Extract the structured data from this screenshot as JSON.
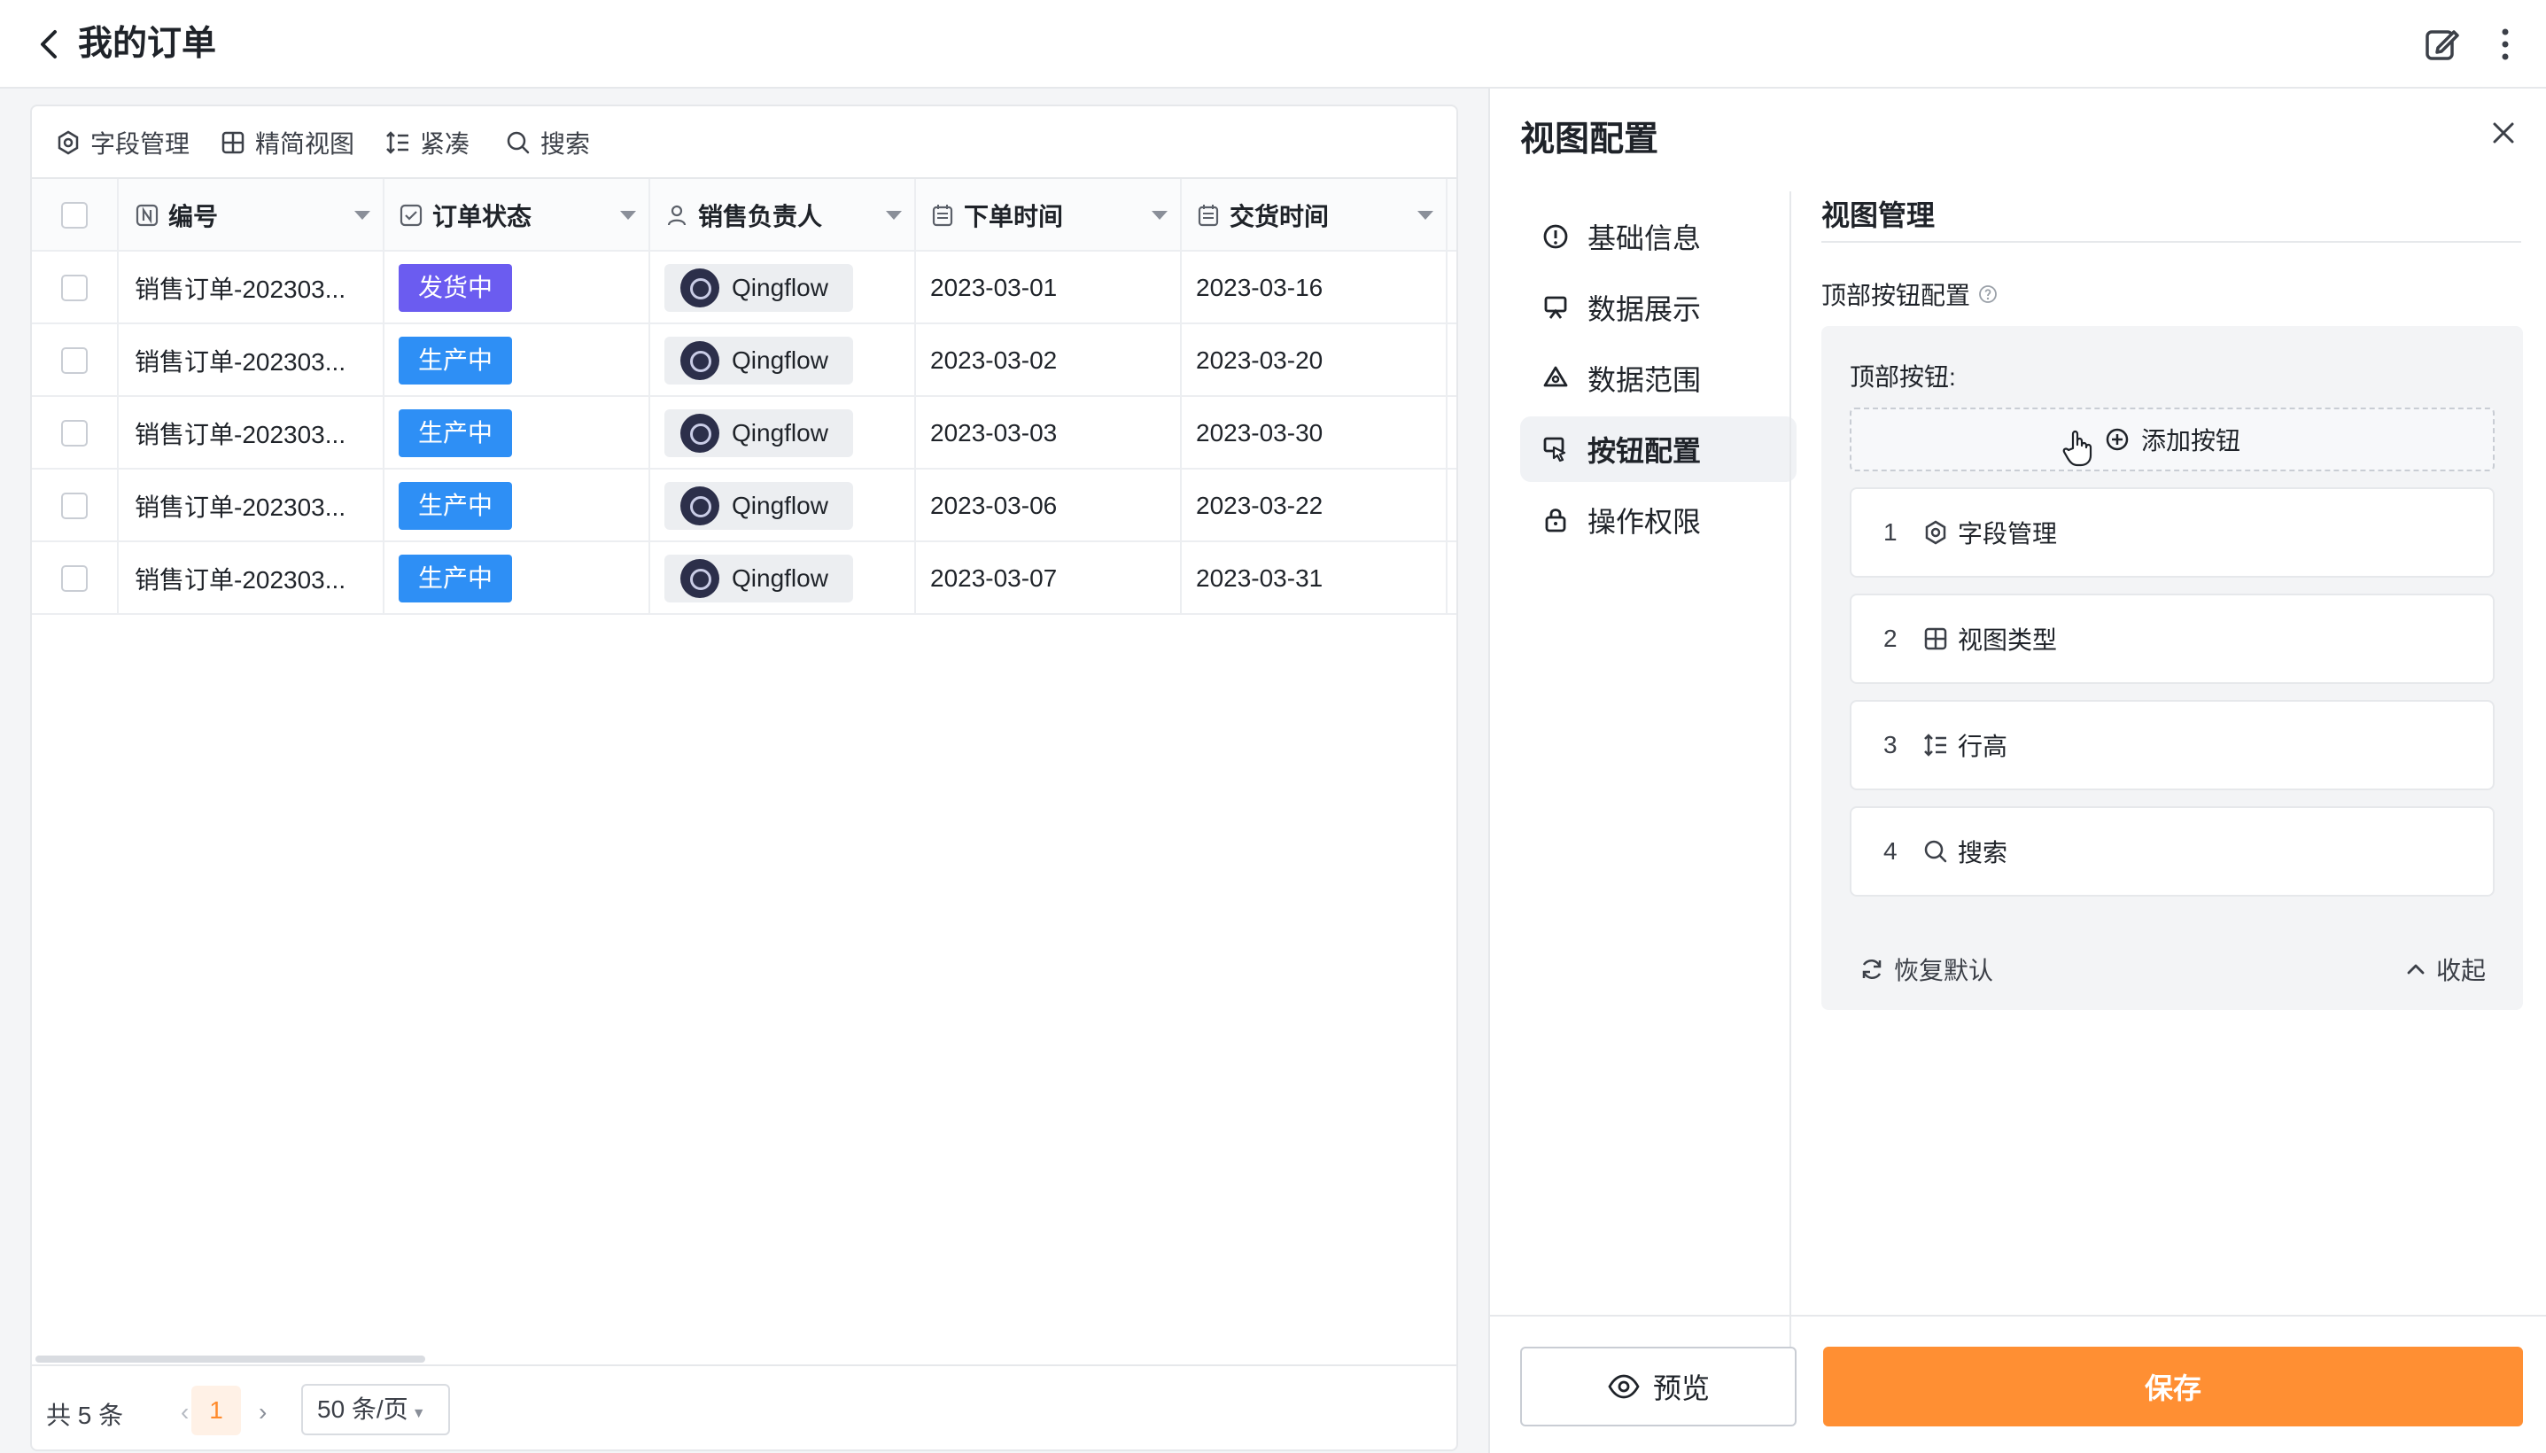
{
  "header": {
    "title": "我的订单",
    "back_icon": "chevron-left-icon",
    "edit_icon": "edit-icon",
    "more_icon": "more-vertical-icon"
  },
  "toolbar": {
    "field_manage": "字段管理",
    "simple_view": "精简视图",
    "compact": "紧凑",
    "search": "搜索"
  },
  "table": {
    "columns": [
      "编号",
      "订单状态",
      "销售负责人",
      "下单时间",
      "交货时间"
    ],
    "rows": [
      {
        "no": "销售订单-202303...",
        "status": "发货中",
        "owner": "Qingflow",
        "order_date": "2023-03-01",
        "delivery_date": "2023-03-16"
      },
      {
        "no": "销售订单-202303...",
        "status": "生产中",
        "owner": "Qingflow",
        "order_date": "2023-03-02",
        "delivery_date": "2023-03-20"
      },
      {
        "no": "销售订单-202303...",
        "status": "生产中",
        "owner": "Qingflow",
        "order_date": "2023-03-03",
        "delivery_date": "2023-03-30"
      },
      {
        "no": "销售订单-202303...",
        "status": "生产中",
        "owner": "Qingflow",
        "order_date": "2023-03-06",
        "delivery_date": "2023-03-22"
      },
      {
        "no": "销售订单-202303...",
        "status": "生产中",
        "owner": "Qingflow",
        "order_date": "2023-03-07",
        "delivery_date": "2023-03-31"
      }
    ],
    "status_colors": {
      "发货中": "#6b5cf0",
      "生产中": "#2e8ff5"
    }
  },
  "footer": {
    "total": "共 5 条",
    "current_page": "1",
    "page_size": "50 条/页"
  },
  "panel": {
    "title": "视图配置",
    "nav": [
      "基础信息",
      "数据展示",
      "数据范围",
      "按钮配置",
      "操作权限"
    ],
    "active_nav": "按钮配置",
    "section_title": "视图管理",
    "sub_label": "顶部按钮配置",
    "top_buttons_label": "顶部按钮:",
    "add_button": "添加按钮",
    "buttons": [
      {
        "num": "1",
        "label": "字段管理",
        "icon": "settings-icon"
      },
      {
        "num": "2",
        "label": "视图类型",
        "icon": "grid-icon"
      },
      {
        "num": "3",
        "label": "行高",
        "icon": "line-height-icon"
      },
      {
        "num": "4",
        "label": "搜索",
        "icon": "search-icon"
      }
    ],
    "restore": "恢复默认",
    "collapse": "收起",
    "preview": "预览",
    "save": "保存"
  },
  "colors": {
    "accent": "#ff8f33",
    "active_page_bg": "#fff1e6"
  }
}
